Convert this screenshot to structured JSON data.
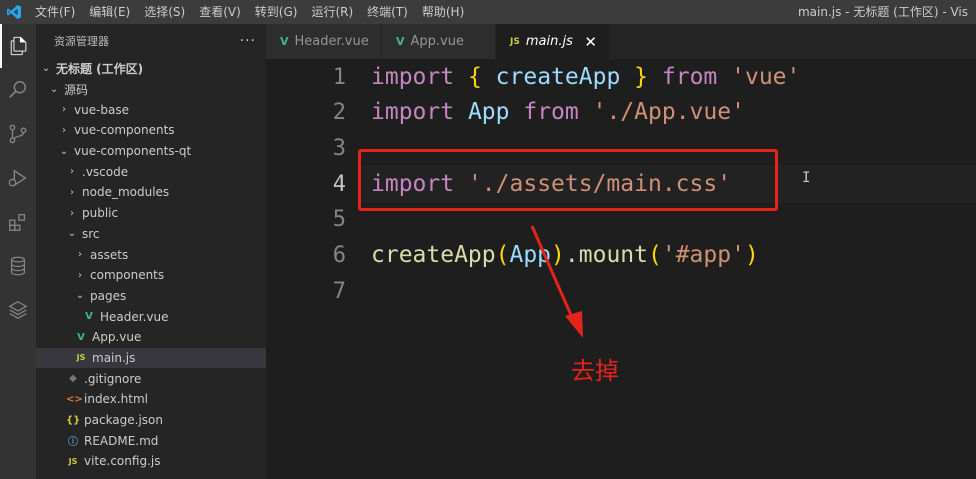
{
  "menu": {
    "items": [
      "文件(F)",
      "编辑(E)",
      "选择(S)",
      "查看(V)",
      "转到(G)",
      "运行(R)",
      "终端(T)",
      "帮助(H)"
    ],
    "window_title": "main.js - 无标题 (工作区) - Vis"
  },
  "activity_bar": {
    "icons": [
      "explorer-icon",
      "search-icon",
      "source-control-icon",
      "run-debug-icon",
      "extensions-icon",
      "database-icon",
      "layers-icon"
    ]
  },
  "explorer": {
    "title": "资源管理器",
    "more": "···",
    "workspace": "无标题 (工作区)",
    "root_folder": "源码",
    "items": [
      {
        "label": "vue-base",
        "type": "folder",
        "expanded": false
      },
      {
        "label": "vue-components",
        "type": "folder",
        "expanded": false
      },
      {
        "label": "vue-components-qt",
        "type": "folder",
        "expanded": true
      },
      {
        "label": ".vscode",
        "type": "folder",
        "expanded": false
      },
      {
        "label": "node_modules",
        "type": "folder",
        "expanded": false
      },
      {
        "label": "public",
        "type": "folder",
        "expanded": false
      },
      {
        "label": "src",
        "type": "folder",
        "expanded": true
      },
      {
        "label": "assets",
        "type": "folder",
        "expanded": false
      },
      {
        "label": "components",
        "type": "folder",
        "expanded": false
      },
      {
        "label": "pages",
        "type": "folder",
        "expanded": true
      },
      {
        "label": "Header.vue",
        "type": "vue"
      },
      {
        "label": "App.vue",
        "type": "vue"
      },
      {
        "label": "main.js",
        "type": "js",
        "selected": true
      },
      {
        "label": ".gitignore",
        "type": "git"
      },
      {
        "label": "index.html",
        "type": "html"
      },
      {
        "label": "package.json",
        "type": "json"
      },
      {
        "label": "README.md",
        "type": "info"
      },
      {
        "label": "vite.config.js",
        "type": "js"
      }
    ]
  },
  "tabs": [
    {
      "label": "Header.vue",
      "icon": "V"
    },
    {
      "label": "App.vue",
      "icon": "V"
    },
    {
      "label": "main.js",
      "icon": "JS",
      "active": true,
      "close": "✕"
    }
  ],
  "editor": {
    "line_numbers": [
      "1",
      "2",
      "3",
      "4",
      "5",
      "6",
      "7"
    ],
    "line1": {
      "kw1": "import",
      "b1": "{",
      "fn": "createApp",
      "b2": "}",
      "kw2": "from",
      "str": "'vue'"
    },
    "line2": {
      "kw1": "import",
      "cls": "App",
      "kw2": "from",
      "str": "'./App.vue'"
    },
    "line4": {
      "kw1": "import",
      "str": "'./assets/main.css'"
    },
    "line6": {
      "fn": "createApp",
      "p1": "(",
      "var": "App",
      "p2": ")",
      "dot": ".",
      "fn2": "mount",
      "p3": "(",
      "str": "'#app'",
      "p4": ")"
    },
    "cursor": "I"
  },
  "annotation": {
    "text": "去掉",
    "color": "#e5231b"
  }
}
